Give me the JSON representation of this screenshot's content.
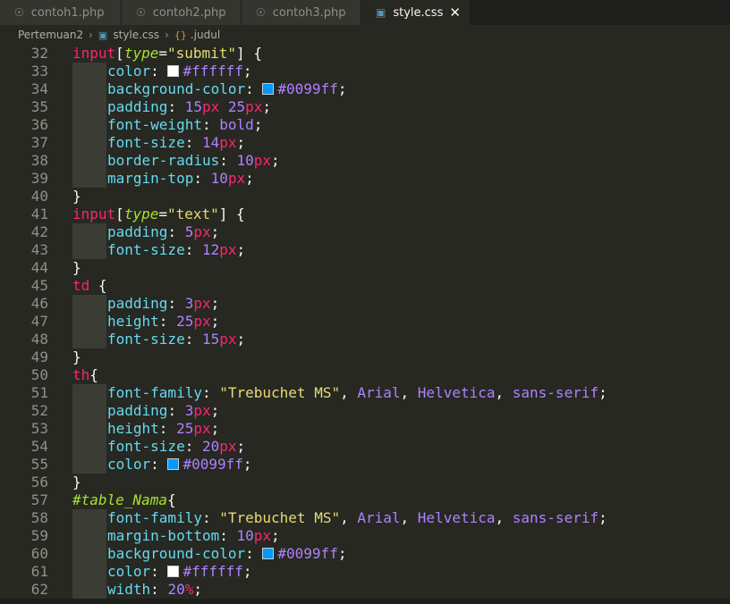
{
  "tabs": [
    {
      "label": "contoh1.php",
      "icon": "php-icon",
      "active": false
    },
    {
      "label": "contoh2.php",
      "icon": "php-icon",
      "active": false
    },
    {
      "label": "contoh3.php",
      "icon": "php-icon",
      "active": false
    },
    {
      "label": "style.css",
      "icon": "css-icon",
      "active": true
    }
  ],
  "breadcrumb": {
    "folder": "Pertemuan2",
    "file": "style.css",
    "symbol": ".judul"
  },
  "swatch_colors": {
    "white": "#ffffff",
    "blue": "#0099ff"
  },
  "lines": [
    {
      "n": "32",
      "indent": 0,
      "tokens": [
        [
          "t-sel",
          "input"
        ],
        [
          "t-punc",
          "["
        ],
        [
          "t-attr",
          "type"
        ],
        [
          "t-punc",
          "="
        ],
        [
          "t-str",
          "\"submit\""
        ],
        [
          "t-punc",
          "] {"
        ]
      ]
    },
    {
      "n": "33",
      "indent": 1,
      "tokens": [
        [
          "t-prop",
          "color"
        ],
        [
          "t-punc",
          ": "
        ],
        [
          "swatch",
          "#ffffff"
        ],
        [
          "t-num",
          "#ffffff"
        ],
        [
          "t-punc",
          ";"
        ]
      ]
    },
    {
      "n": "34",
      "indent": 1,
      "tokens": [
        [
          "t-prop",
          "background-color"
        ],
        [
          "t-punc",
          ": "
        ],
        [
          "swatch",
          "#0099ff"
        ],
        [
          "t-num",
          "#0099ff"
        ],
        [
          "t-punc",
          ";"
        ]
      ]
    },
    {
      "n": "35",
      "indent": 1,
      "tokens": [
        [
          "t-prop",
          "padding"
        ],
        [
          "t-punc",
          ": "
        ],
        [
          "t-num",
          "15"
        ],
        [
          "t-unit",
          "px"
        ],
        [
          "t-punc",
          " "
        ],
        [
          "t-num",
          "25"
        ],
        [
          "t-unit",
          "px"
        ],
        [
          "t-punc",
          ";"
        ]
      ]
    },
    {
      "n": "36",
      "indent": 1,
      "tokens": [
        [
          "t-prop",
          "font-weight"
        ],
        [
          "t-punc",
          ": "
        ],
        [
          "t-kw",
          "bold"
        ],
        [
          "t-punc",
          ";"
        ]
      ]
    },
    {
      "n": "37",
      "indent": 1,
      "tokens": [
        [
          "t-prop",
          "font-size"
        ],
        [
          "t-punc",
          ": "
        ],
        [
          "t-num",
          "14"
        ],
        [
          "t-unit",
          "px"
        ],
        [
          "t-punc",
          ";"
        ]
      ]
    },
    {
      "n": "38",
      "indent": 1,
      "tokens": [
        [
          "t-prop",
          "border-radius"
        ],
        [
          "t-punc",
          ": "
        ],
        [
          "t-num",
          "10"
        ],
        [
          "t-unit",
          "px"
        ],
        [
          "t-punc",
          ";"
        ]
      ]
    },
    {
      "n": "39",
      "indent": 1,
      "tokens": [
        [
          "t-prop",
          "margin-top"
        ],
        [
          "t-punc",
          ": "
        ],
        [
          "t-num",
          "10"
        ],
        [
          "t-unit",
          "px"
        ],
        [
          "t-punc",
          ";"
        ]
      ]
    },
    {
      "n": "40",
      "indent": 0,
      "tokens": [
        [
          "t-punc",
          "}"
        ]
      ]
    },
    {
      "n": "41",
      "indent": 0,
      "tokens": [
        [
          "t-sel",
          "input"
        ],
        [
          "t-punc",
          "["
        ],
        [
          "t-attr",
          "type"
        ],
        [
          "t-punc",
          "="
        ],
        [
          "t-str",
          "\"text\""
        ],
        [
          "t-punc",
          "] {"
        ]
      ]
    },
    {
      "n": "42",
      "indent": 1,
      "tokens": [
        [
          "t-prop",
          "padding"
        ],
        [
          "t-punc",
          ": "
        ],
        [
          "t-num",
          "5"
        ],
        [
          "t-unit",
          "px"
        ],
        [
          "t-punc",
          ";"
        ]
      ]
    },
    {
      "n": "43",
      "indent": 1,
      "tokens": [
        [
          "t-prop",
          "font-size"
        ],
        [
          "t-punc",
          ": "
        ],
        [
          "t-num",
          "12"
        ],
        [
          "t-unit",
          "px"
        ],
        [
          "t-punc",
          ";"
        ]
      ]
    },
    {
      "n": "44",
      "indent": 0,
      "tokens": [
        [
          "t-punc",
          "}"
        ]
      ]
    },
    {
      "n": "45",
      "indent": 0,
      "tokens": [
        [
          "t-sel",
          "td"
        ],
        [
          "t-punc",
          " {"
        ]
      ]
    },
    {
      "n": "46",
      "indent": 1,
      "tokens": [
        [
          "t-prop",
          "padding"
        ],
        [
          "t-punc",
          ": "
        ],
        [
          "t-num",
          "3"
        ],
        [
          "t-unit",
          "px"
        ],
        [
          "t-punc",
          ";"
        ]
      ]
    },
    {
      "n": "47",
      "indent": 1,
      "tokens": [
        [
          "t-prop",
          "height"
        ],
        [
          "t-punc",
          ": "
        ],
        [
          "t-num",
          "25"
        ],
        [
          "t-unit",
          "px"
        ],
        [
          "t-punc",
          ";"
        ]
      ]
    },
    {
      "n": "48",
      "indent": 1,
      "tokens": [
        [
          "t-prop",
          "font-size"
        ],
        [
          "t-punc",
          ": "
        ],
        [
          "t-num",
          "15"
        ],
        [
          "t-unit",
          "px"
        ],
        [
          "t-punc",
          ";"
        ]
      ]
    },
    {
      "n": "49",
      "indent": 0,
      "tokens": [
        [
          "t-punc",
          "}"
        ]
      ]
    },
    {
      "n": "50",
      "indent": 0,
      "tokens": [
        [
          "t-sel",
          "th"
        ],
        [
          "t-punc",
          "{"
        ]
      ]
    },
    {
      "n": "51",
      "indent": 1,
      "tokens": [
        [
          "t-prop",
          "font-family"
        ],
        [
          "t-punc",
          ": "
        ],
        [
          "t-str",
          "\"Trebuchet MS\""
        ],
        [
          "t-punc",
          ", "
        ],
        [
          "t-kw",
          "Arial"
        ],
        [
          "t-punc",
          ", "
        ],
        [
          "t-kw",
          "Helvetica"
        ],
        [
          "t-punc",
          ", "
        ],
        [
          "t-kw",
          "sans-serif"
        ],
        [
          "t-punc",
          ";"
        ]
      ]
    },
    {
      "n": "52",
      "indent": 1,
      "tokens": [
        [
          "t-prop",
          "padding"
        ],
        [
          "t-punc",
          ": "
        ],
        [
          "t-num",
          "3"
        ],
        [
          "t-unit",
          "px"
        ],
        [
          "t-punc",
          ";"
        ]
      ]
    },
    {
      "n": "53",
      "indent": 1,
      "tokens": [
        [
          "t-prop",
          "height"
        ],
        [
          "t-punc",
          ": "
        ],
        [
          "t-num",
          "25"
        ],
        [
          "t-unit",
          "px"
        ],
        [
          "t-punc",
          ";"
        ]
      ]
    },
    {
      "n": "54",
      "indent": 1,
      "tokens": [
        [
          "t-prop",
          "font-size"
        ],
        [
          "t-punc",
          ": "
        ],
        [
          "t-num",
          "20"
        ],
        [
          "t-unit",
          "px"
        ],
        [
          "t-punc",
          ";"
        ]
      ]
    },
    {
      "n": "55",
      "indent": 1,
      "tokens": [
        [
          "t-prop",
          "color"
        ],
        [
          "t-punc",
          ": "
        ],
        [
          "swatch",
          "#0099ff"
        ],
        [
          "t-num",
          "#0099ff"
        ],
        [
          "t-punc",
          ";"
        ]
      ]
    },
    {
      "n": "56",
      "indent": 0,
      "tokens": [
        [
          "t-punc",
          "}"
        ]
      ]
    },
    {
      "n": "57",
      "indent": 0,
      "tokens": [
        [
          "t-id",
          "#table_Nama"
        ],
        [
          "t-punc",
          "{"
        ]
      ]
    },
    {
      "n": "58",
      "indent": 1,
      "tokens": [
        [
          "t-prop",
          "font-family"
        ],
        [
          "t-punc",
          ": "
        ],
        [
          "t-str",
          "\"Trebuchet MS\""
        ],
        [
          "t-punc",
          ", "
        ],
        [
          "t-kw",
          "Arial"
        ],
        [
          "t-punc",
          ", "
        ],
        [
          "t-kw",
          "Helvetica"
        ],
        [
          "t-punc",
          ", "
        ],
        [
          "t-kw",
          "sans-serif"
        ],
        [
          "t-punc",
          ";"
        ]
      ]
    },
    {
      "n": "59",
      "indent": 1,
      "tokens": [
        [
          "t-prop",
          "margin-bottom"
        ],
        [
          "t-punc",
          ": "
        ],
        [
          "t-num",
          "10"
        ],
        [
          "t-unit",
          "px"
        ],
        [
          "t-punc",
          ";"
        ]
      ]
    },
    {
      "n": "60",
      "indent": 1,
      "tokens": [
        [
          "t-prop",
          "background-color"
        ],
        [
          "t-punc",
          ": "
        ],
        [
          "swatch",
          "#0099ff"
        ],
        [
          "t-num",
          "#0099ff"
        ],
        [
          "t-punc",
          ";"
        ]
      ]
    },
    {
      "n": "61",
      "indent": 1,
      "tokens": [
        [
          "t-prop",
          "color"
        ],
        [
          "t-punc",
          ": "
        ],
        [
          "swatch",
          "#ffffff"
        ],
        [
          "t-num",
          "#ffffff"
        ],
        [
          "t-punc",
          ";"
        ]
      ]
    },
    {
      "n": "62",
      "indent": 1,
      "tokens": [
        [
          "t-prop",
          "width"
        ],
        [
          "t-punc",
          ": "
        ],
        [
          "t-num",
          "20"
        ],
        [
          "t-unit",
          "%"
        ],
        [
          "t-punc",
          ";"
        ]
      ]
    }
  ]
}
